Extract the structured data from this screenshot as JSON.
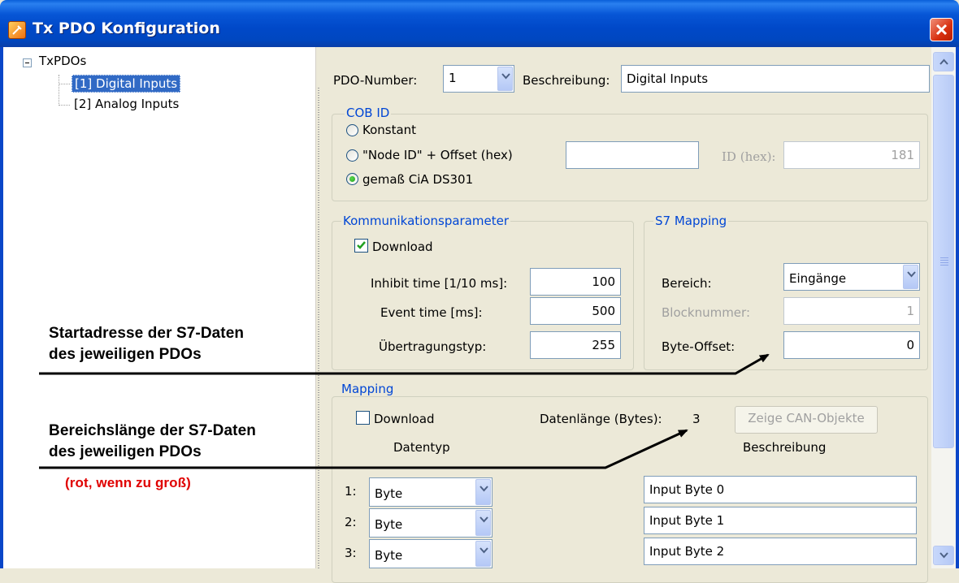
{
  "window": {
    "title": "Tx PDO Konfiguration"
  },
  "tree": {
    "root_label": "TxPDOs",
    "items": [
      {
        "label": "[1] Digital Inputs",
        "selected": true
      },
      {
        "label": "[2] Analog Inputs",
        "selected": false
      }
    ]
  },
  "form": {
    "pdo_number_label": "PDO-Number:",
    "pdo_number_value": "1",
    "description_label": "Beschreibung:",
    "description_value": "Digital Inputs",
    "cob_id": {
      "title": "COB ID",
      "options": [
        {
          "label": "Konstant",
          "selected": false
        },
        {
          "label": "\"Node ID\" + Offset (hex)",
          "selected": false
        },
        {
          "label": "gemaß CiA DS301",
          "selected": true
        }
      ],
      "offset_value": "",
      "id_hex_label": "ID (hex):",
      "id_hex_value": "181"
    },
    "communication": {
      "title": "Kommunikationsparameter",
      "download_label": "Download",
      "download_checked": true,
      "inhibit_label": "Inhibit time [1/10 ms]:",
      "inhibit_value": "100",
      "event_label": "Event time [ms]:",
      "event_value": "500",
      "transfer_label": "Übertragungstyp:",
      "transfer_value": "255"
    },
    "s7_mapping": {
      "title": "S7 Mapping",
      "area_label": "Bereich:",
      "area_value": "Eingänge",
      "block_label": "Blocknummer:",
      "block_value": "1",
      "byte_offset_label": "Byte-Offset:",
      "byte_offset_value": "0"
    },
    "mapping": {
      "title": "Mapping",
      "download_label": "Download",
      "download_checked": false,
      "data_length_label": "Datenlänge (Bytes):",
      "data_length_value": "3",
      "show_can_button": "Zeige CAN-Objekte",
      "datatype_header": "Datentyp",
      "description_header": "Beschreibung",
      "rows": [
        {
          "index": "1:",
          "type": "Byte",
          "description": "Input Byte 0"
        },
        {
          "index": "2:",
          "type": "Byte",
          "description": "Input Byte 1"
        },
        {
          "index": "3:",
          "type": "Byte",
          "description": "Input Byte 2"
        }
      ]
    }
  },
  "annotations": {
    "start_line1": "Startadresse der S7-Daten",
    "start_line2": "des jeweiligen PDOs",
    "range_line1": "Bereichslänge der S7-Daten",
    "range_line2": "des jeweiligen PDOs",
    "range_note": "(rot, wenn zu groß)"
  },
  "colors": {
    "titlebar": "#0a46c8",
    "group_title": "#0046d5",
    "selection": "#316ac5",
    "annotation_note": "#e00000"
  },
  "icons": [
    "app-icon",
    "close-icon",
    "chevron-down-icon",
    "scroll-up-icon",
    "scroll-down-icon",
    "checkmark-icon"
  ]
}
